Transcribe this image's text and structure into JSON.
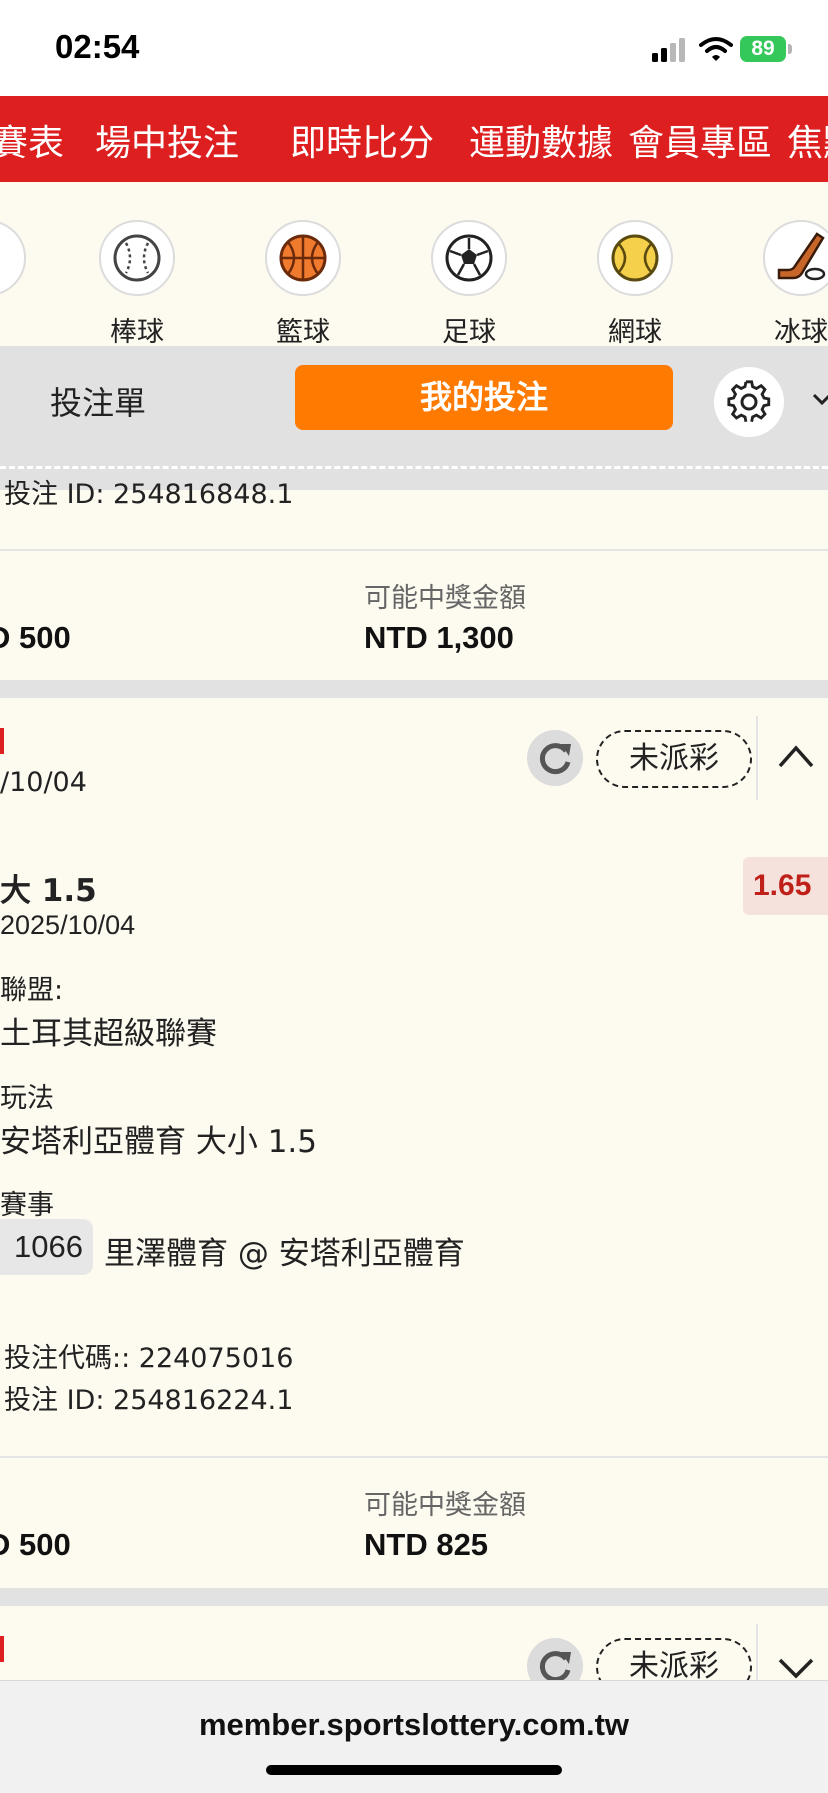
{
  "status_bar": {
    "time": "02:54",
    "battery": "89"
  },
  "top_nav": {
    "items": [
      "賽表",
      "場中投注",
      "即時比分",
      "運動數據",
      "會員專區",
      "焦點"
    ]
  },
  "sports": [
    {
      "label": "棒球",
      "icon": "baseball-icon"
    },
    {
      "label": "籃球",
      "icon": "basketball-icon"
    },
    {
      "label": "足球",
      "icon": "soccer-ball-icon"
    },
    {
      "label": "網球",
      "icon": "tennis-ball-icon"
    },
    {
      "label": "冰球",
      "icon": "hockey-icon"
    }
  ],
  "bet_tabs": {
    "slip": "投注單",
    "my_bets": "我的投注"
  },
  "card1": {
    "bet_id_partial": "投注 ID: 254816848.1",
    "stake": "D 500",
    "payout_label": "可能中獎金額",
    "payout": "NTD 1,300"
  },
  "card2": {
    "date_partial": "/10/04",
    "status": "未派彩",
    "selection": "大 1.5",
    "odds": "1.65",
    "event_date": "2025/10/04",
    "league_label": "聯盟:",
    "league": "土耳其超級聯賽",
    "market_label": "玩法",
    "market": "安塔利亞體育 大小 1.5",
    "match_label": "賽事",
    "match_code": "1066",
    "match": "里澤體育 @ 安塔利亞體育",
    "bet_code": "投注代碼:: 224075016",
    "bet_id": "投注 ID: 254816224.1",
    "stake": "D 500",
    "payout_label": "可能中獎金額",
    "payout": "NTD 825"
  },
  "card3": {
    "status": "未派彩"
  },
  "browser": {
    "url": "member.sportslottery.com.tw"
  },
  "colors": {
    "nav_red": "#dd1f1f",
    "accent_orange": "#ff7a00",
    "odds_red": "#c0201a",
    "battery_green": "#34c759"
  }
}
